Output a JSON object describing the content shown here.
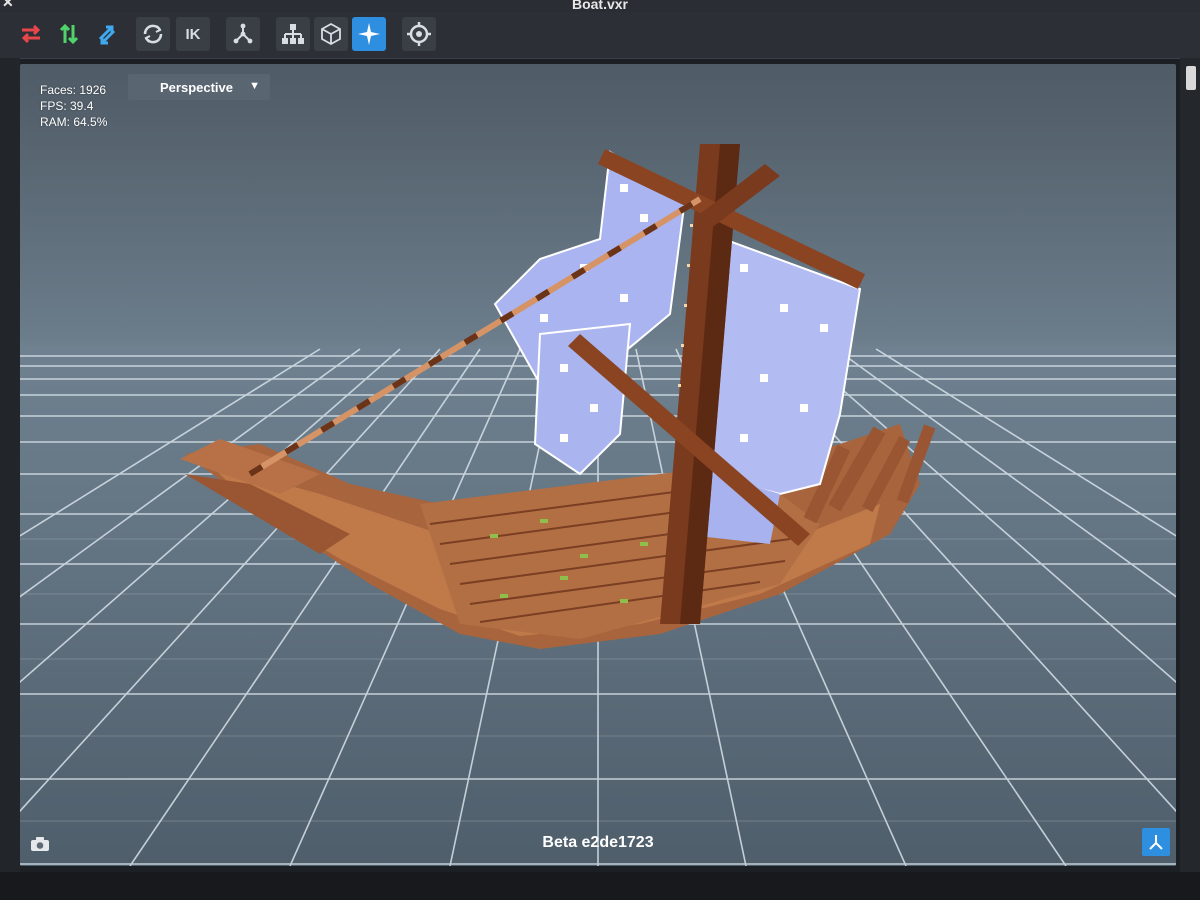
{
  "window": {
    "title": "Boat.vxr"
  },
  "toolbar": {
    "ik_label": "IK",
    "active_tool": "select-star",
    "accent_color": "#2e8fe0"
  },
  "viewport": {
    "stats": {
      "faces": "Faces: 1926",
      "fps": "FPS: 39.4",
      "ram": "RAM: 64.5%"
    },
    "view_mode": "Perspective",
    "version": "Beta e2de1723",
    "model": "voxel shipwreck with tattered sails"
  }
}
